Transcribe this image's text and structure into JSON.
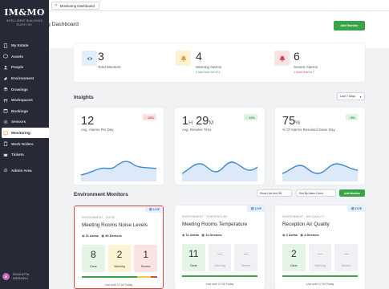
{
  "sidebar": {
    "logo": "IM&MO",
    "logo_sub": [
      "INTELLIGENT BUILDINGS",
      "PLATFORM"
    ],
    "items": [
      {
        "label": "My Estate",
        "icon": "building-icon"
      },
      {
        "label": "Assets",
        "icon": "cube-icon"
      },
      {
        "label": "People",
        "icon": "people-icon"
      },
      {
        "label": "Environment",
        "icon": "leaf-icon"
      },
      {
        "label": "Drawings",
        "icon": "layers-icon"
      },
      {
        "label": "Workspaces",
        "icon": "desk-icon"
      },
      {
        "label": "Bookings",
        "icon": "calendar-icon"
      },
      {
        "label": "Sensors",
        "icon": "sensor-icon"
      },
      {
        "label": "Monitoring",
        "icon": "monitor-icon",
        "active": true
      },
      {
        "label": "Work Orders",
        "icon": "clipboard-icon"
      },
      {
        "label": "Tickets",
        "icon": "ticket-icon"
      },
      {
        "label": "Admin Area",
        "icon": "gear-icon"
      }
    ],
    "user": {
      "initials": "SI",
      "name_line1": "SENGUPTA",
      "name_line2": "INDRANUJ"
    }
  },
  "topbar": {
    "tab_label": "Monitoring Dashboard"
  },
  "header": {
    "title": "Monitoring Dashboard",
    "add_button": "Add Monitor"
  },
  "summary": [
    {
      "value": "3",
      "label": "Total Monitors",
      "sub": "",
      "icon": "eye-icon"
    },
    {
      "value": "4",
      "label": "Warning Alarms",
      "sub": "2 last hour out of 4",
      "icon": "bell-icon"
    },
    {
      "value": "6",
      "label": "Severe Alarms",
      "sub": "1 more than a 7",
      "icon": "alert-bell-icon"
    }
  ],
  "insights": {
    "title": "Insights",
    "range": "Last 7 Days",
    "cards": [
      {
        "value": "12",
        "label": "Avg. Alarms Per Day",
        "badge": "↑ 12%"
      },
      {
        "value_h": "1",
        "unit_h": "H",
        "value_m": "29",
        "unit_m": "M",
        "label": "Avg. Resolve Time",
        "badge": "↓ 12%"
      },
      {
        "value": "75",
        "unit": "%",
        "label": "% Of Alarms Resolved Same Day",
        "badge": "↑ 8%"
      }
    ]
  },
  "environment": {
    "title": "Environment Monitors",
    "filter": "Show Live And Off",
    "sort": "Sort By Alarm Count",
    "add_button": "Add Monitor",
    "monitors": [
      {
        "live": "LIVE",
        "category": "ENVIRONMENT · NOISE",
        "title": "Meeting Rooms Noise Levels",
        "areas": "11 Areas",
        "devices": "30 Devices",
        "tiles": [
          {
            "n": "8",
            "t": "Clear"
          },
          {
            "n": "2",
            "t": "Warning"
          },
          {
            "n": "1",
            "t": "Severe"
          }
        ],
        "footer": "Live until 17:00 Today"
      },
      {
        "live": "LIVE",
        "category": "ENVIRONMENT · TEMPERATURE",
        "title": "Meeting Rooms Temperature",
        "areas": "11 Areas",
        "devices": "11 Devices",
        "tiles": [
          {
            "n": "11",
            "t": "Clear"
          },
          {
            "n": "–",
            "t": "Warning"
          },
          {
            "n": "–",
            "t": "Severe"
          }
        ],
        "footer": "Live until 17:00 Today"
      },
      {
        "live": "LIVE",
        "category": "ENVIRONMENT · AIR QUALITY",
        "title": "Reception Air Quality",
        "areas": "2 Areas",
        "devices": "4 Devices",
        "tiles": [
          {
            "n": "2",
            "t": "Clear"
          },
          {
            "n": "–",
            "t": "Warning"
          },
          {
            "n": "–",
            "t": "Severe"
          }
        ],
        "footer": "Live until 17:00 Today"
      }
    ]
  },
  "colors": {
    "sidebar": "#252a36",
    "accent_green": "#3aa34a",
    "severe_red": "#d94646",
    "warning_yellow": "#f2c94c",
    "chart_blue": "#3b86d8"
  }
}
